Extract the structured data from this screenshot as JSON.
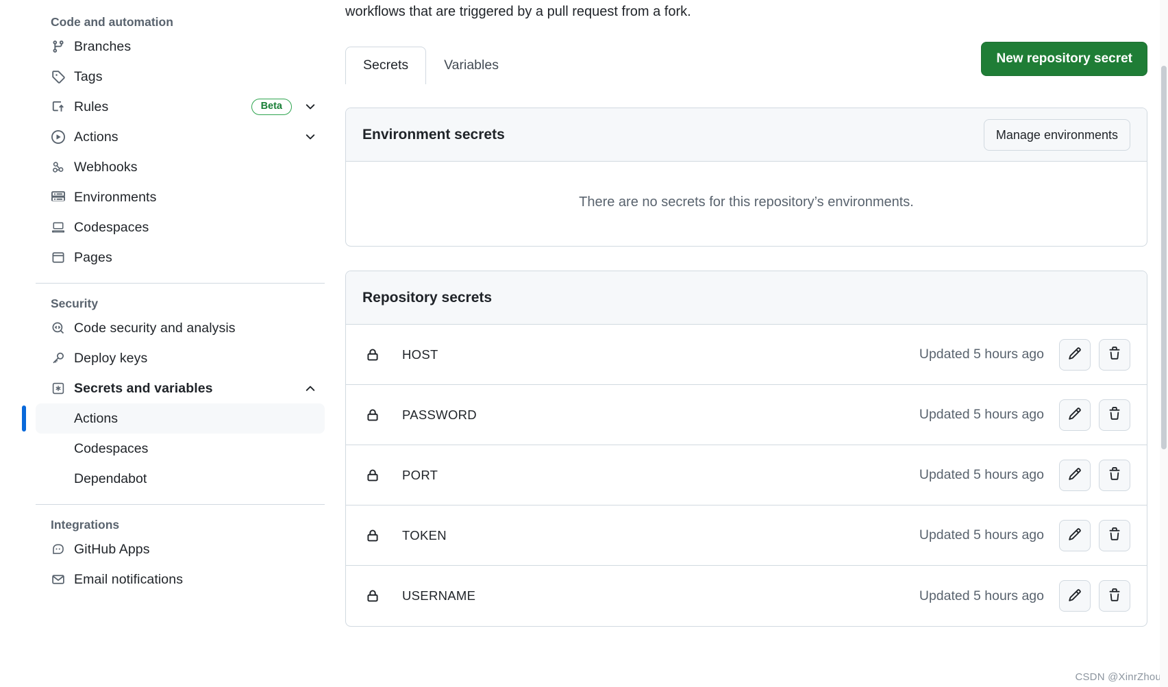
{
  "sidebar": {
    "groups": [
      {
        "title": "Code and automation",
        "items": [
          {
            "label": "Branches",
            "icon": "git-branch-icon"
          },
          {
            "label": "Tags",
            "icon": "tag-icon"
          },
          {
            "label": "Rules",
            "icon": "rules-icon",
            "badge": "Beta",
            "chevron": "chevron-down"
          },
          {
            "label": "Actions",
            "icon": "play-circle-icon",
            "chevron": "chevron-down"
          },
          {
            "label": "Webhooks",
            "icon": "webhook-icon"
          },
          {
            "label": "Environments",
            "icon": "server-icon"
          },
          {
            "label": "Codespaces",
            "icon": "codespaces-icon"
          },
          {
            "label": "Pages",
            "icon": "browser-icon"
          }
        ]
      },
      {
        "title": "Security",
        "items": [
          {
            "label": "Code security and analysis",
            "icon": "code-scan-icon"
          },
          {
            "label": "Deploy keys",
            "icon": "key-icon"
          },
          {
            "label": "Secrets and variables",
            "icon": "asterisk-box-icon",
            "chevron": "chevron-up",
            "bold": true
          }
        ],
        "subitems": [
          {
            "label": "Actions",
            "active": true
          },
          {
            "label": "Codespaces",
            "active": false
          },
          {
            "label": "Dependabot",
            "active": false
          }
        ]
      },
      {
        "title": "Integrations",
        "items": [
          {
            "label": "GitHub Apps",
            "icon": "github-apps-icon"
          },
          {
            "label": "Email notifications",
            "icon": "mail-icon"
          }
        ]
      }
    ]
  },
  "main": {
    "intro_text": "workflows that are triggered by a pull request from a fork.",
    "tabs": [
      {
        "label": "Secrets",
        "active": true
      },
      {
        "label": "Variables",
        "active": false
      }
    ],
    "new_secret_button": "New repository secret",
    "environment_secrets": {
      "title": "Environment secrets",
      "manage_button": "Manage environments",
      "empty_message": "There are no secrets for this repository’s environments."
    },
    "repository_secrets": {
      "title": "Repository secrets",
      "rows": [
        {
          "name": "HOST",
          "updated": "Updated 5 hours ago",
          "edit_icon": "pencil-icon",
          "delete_icon": "trash-icon"
        },
        {
          "name": "PASSWORD",
          "updated": "Updated 5 hours ago",
          "edit_icon": "pencil-icon",
          "delete_icon": "trash-icon"
        },
        {
          "name": "PORT",
          "updated": "Updated 5 hours ago",
          "edit_icon": "pencil-icon",
          "delete_icon": "trash-icon"
        },
        {
          "name": "TOKEN",
          "updated": "Updated 5 hours ago",
          "edit_icon": "pencil-icon",
          "delete_icon": "trash-icon"
        },
        {
          "name": "USERNAME",
          "updated": "Updated 5 hours ago",
          "edit_icon": "pencil-icon",
          "delete_icon": "trash-icon"
        }
      ]
    }
  },
  "watermark": "CSDN @XinrZhou",
  "colors": {
    "accent_green": "#1f7d36",
    "active_blue": "#0969da",
    "beta_green": "#1a7f37",
    "border": "#d1d9e0",
    "muted_text": "#59636e",
    "surface": "#f6f8fa"
  }
}
